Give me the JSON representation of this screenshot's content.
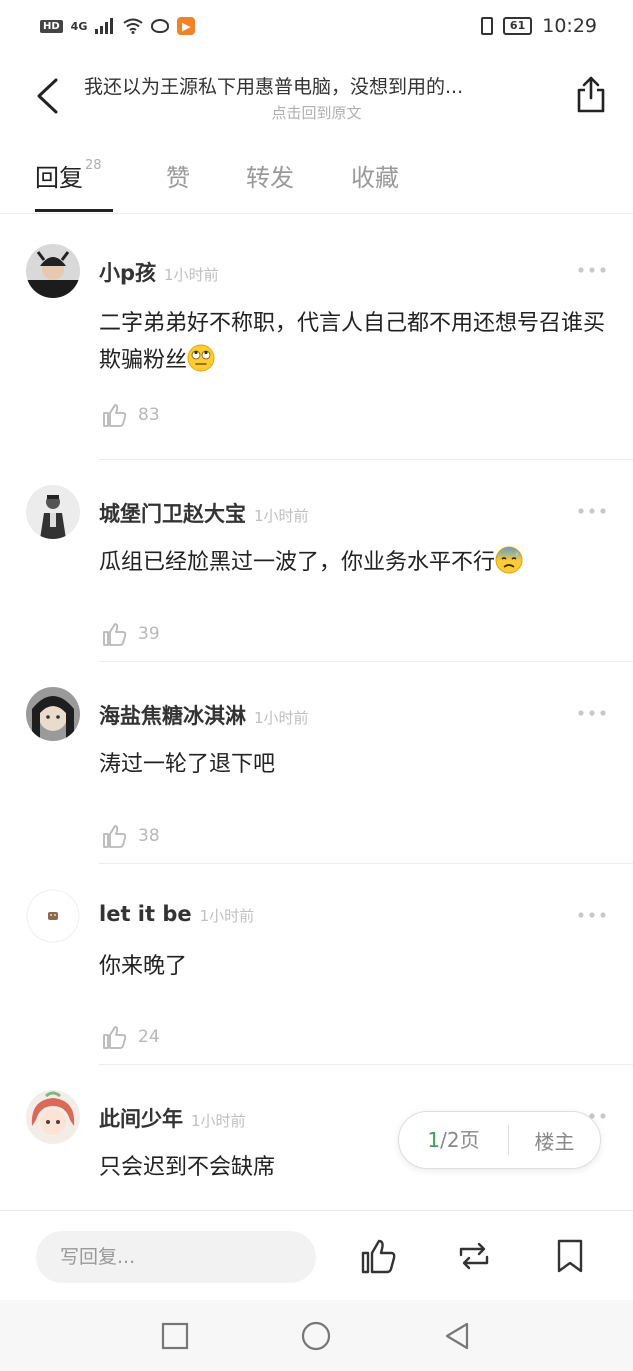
{
  "status": {
    "hd": "HD",
    "network": "4G",
    "battery": "61",
    "time": "10:29"
  },
  "header": {
    "title": "我还以为王源私下用惠普电脑，没想到用的...",
    "subtitle": "点击回到原文"
  },
  "tabs": [
    {
      "label": "回复",
      "count": "28"
    },
    {
      "label": "赞"
    },
    {
      "label": "转发"
    },
    {
      "label": "收藏"
    }
  ],
  "comments": [
    {
      "name": "小p孩",
      "time": "1小时前",
      "text": "二字弟弟好不称职，代言人自己都不用还想号召谁买欺骗粉丝",
      "emoji": "eye-roll-emoji",
      "likes": "83"
    },
    {
      "name": "城堡门卫赵大宝",
      "time": "1小时前",
      "text": "瓜组已经尬黑过一波了，你业务水平不行",
      "emoji": "cold-sweat-emoji",
      "likes": "39"
    },
    {
      "name": "海盐焦糖冰淇淋",
      "time": "1小时前",
      "text": "涛过一轮了退下吧",
      "likes": "38"
    },
    {
      "name": "let it be",
      "time": "1小时前",
      "text": "你来晚了",
      "likes": "24"
    },
    {
      "name": "此间少年",
      "time": "1小时前",
      "text": "只会迟到不会缺席"
    }
  ],
  "pager": {
    "current": "1",
    "total": "/2页",
    "owner": "楼主"
  },
  "bottom": {
    "reply_placeholder": "写回复..."
  },
  "colors": {
    "accent_green": "#3ba55c",
    "text_primary": "#222222",
    "text_muted": "#b8b8b8"
  }
}
